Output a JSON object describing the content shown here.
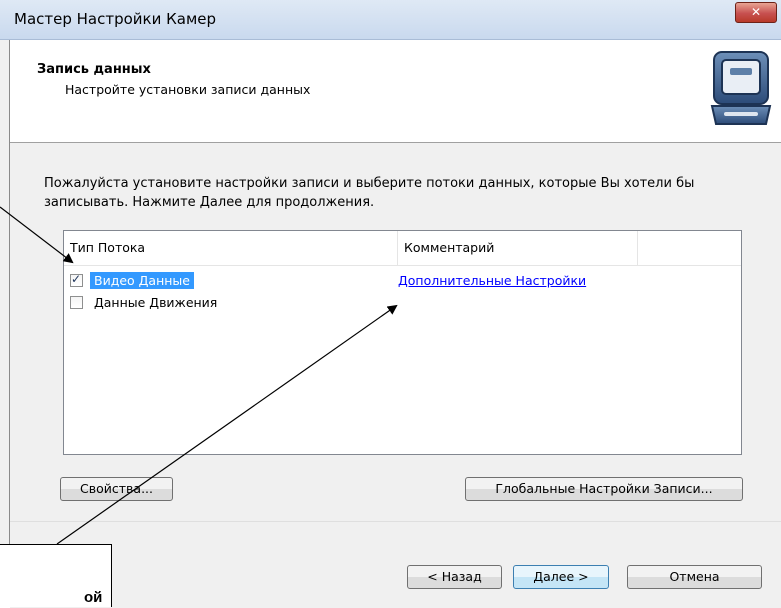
{
  "window": {
    "title": "Мастер Настройки Камер",
    "close_label": "✕"
  },
  "header": {
    "title": "Запись данных",
    "subtitle": "Настройте установки записи данных",
    "icon": "monitor-icon"
  },
  "description": "Пожалуйста установите настройки записи и выберите потоки данных, которые Вы хотели бы записывать. Нажмите Далее для продолжения.",
  "list": {
    "columns": [
      "Тип Потока",
      "Комментарий"
    ],
    "rows": [
      {
        "label": "Видео Данные",
        "checked": true,
        "selected": true,
        "comment": "Дополнительные Настройки"
      },
      {
        "label": "Данные Движения",
        "checked": false,
        "selected": false,
        "comment": ""
      }
    ]
  },
  "buttons": {
    "properties": "Свойства...",
    "global_settings": "Глобальные Настройки Записи...",
    "back": "< Назад",
    "next": "Далее >",
    "cancel": "Отмена"
  },
  "annotation": {
    "callout_text": "ой"
  }
}
